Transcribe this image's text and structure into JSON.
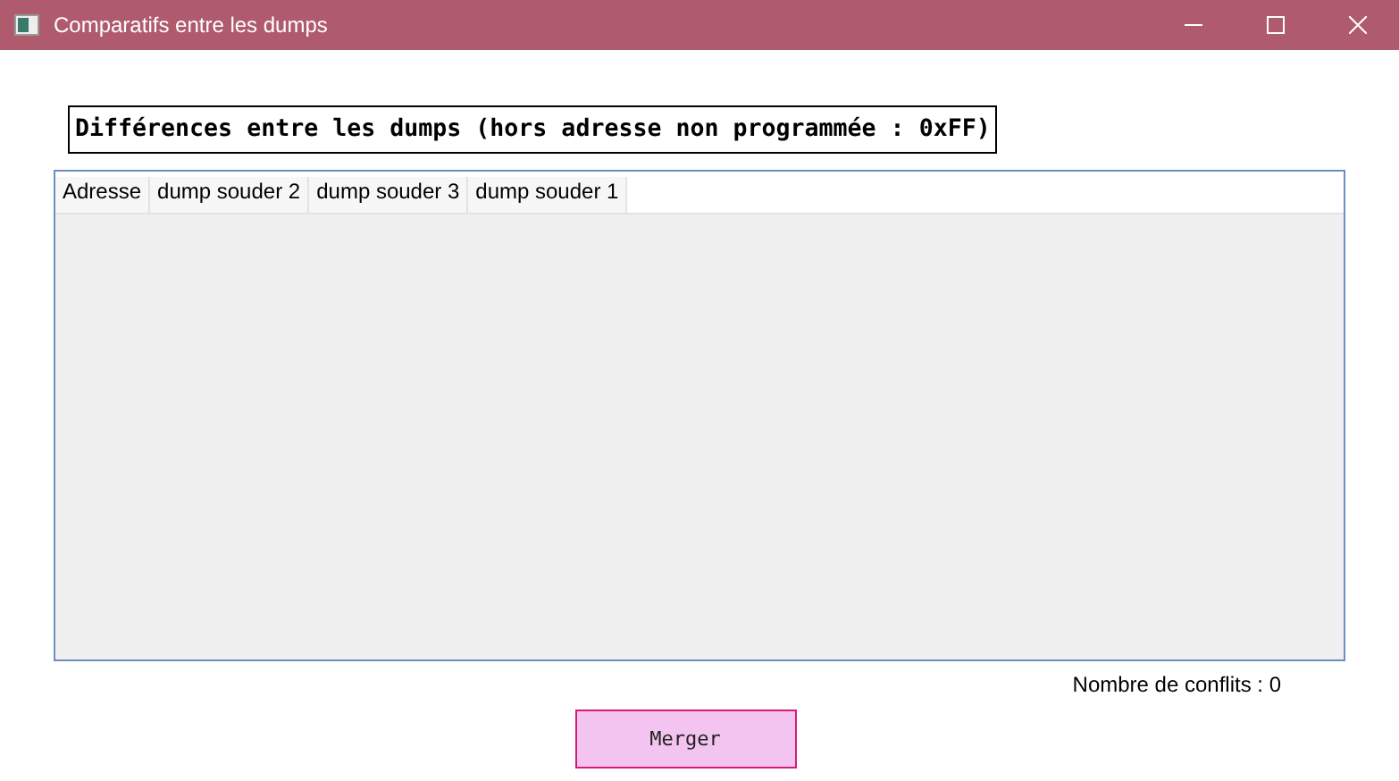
{
  "window": {
    "title": "Comparatifs entre les dumps"
  },
  "heading": "Différences entre les dumps (hors adresse non programmée : 0xFF)",
  "table": {
    "columns": [
      "Adresse",
      "dump souder 2",
      "dump souder 3",
      "dump souder 1"
    ]
  },
  "conflicts": "Nombre de conflits : 0",
  "merge_button": "Merger"
}
